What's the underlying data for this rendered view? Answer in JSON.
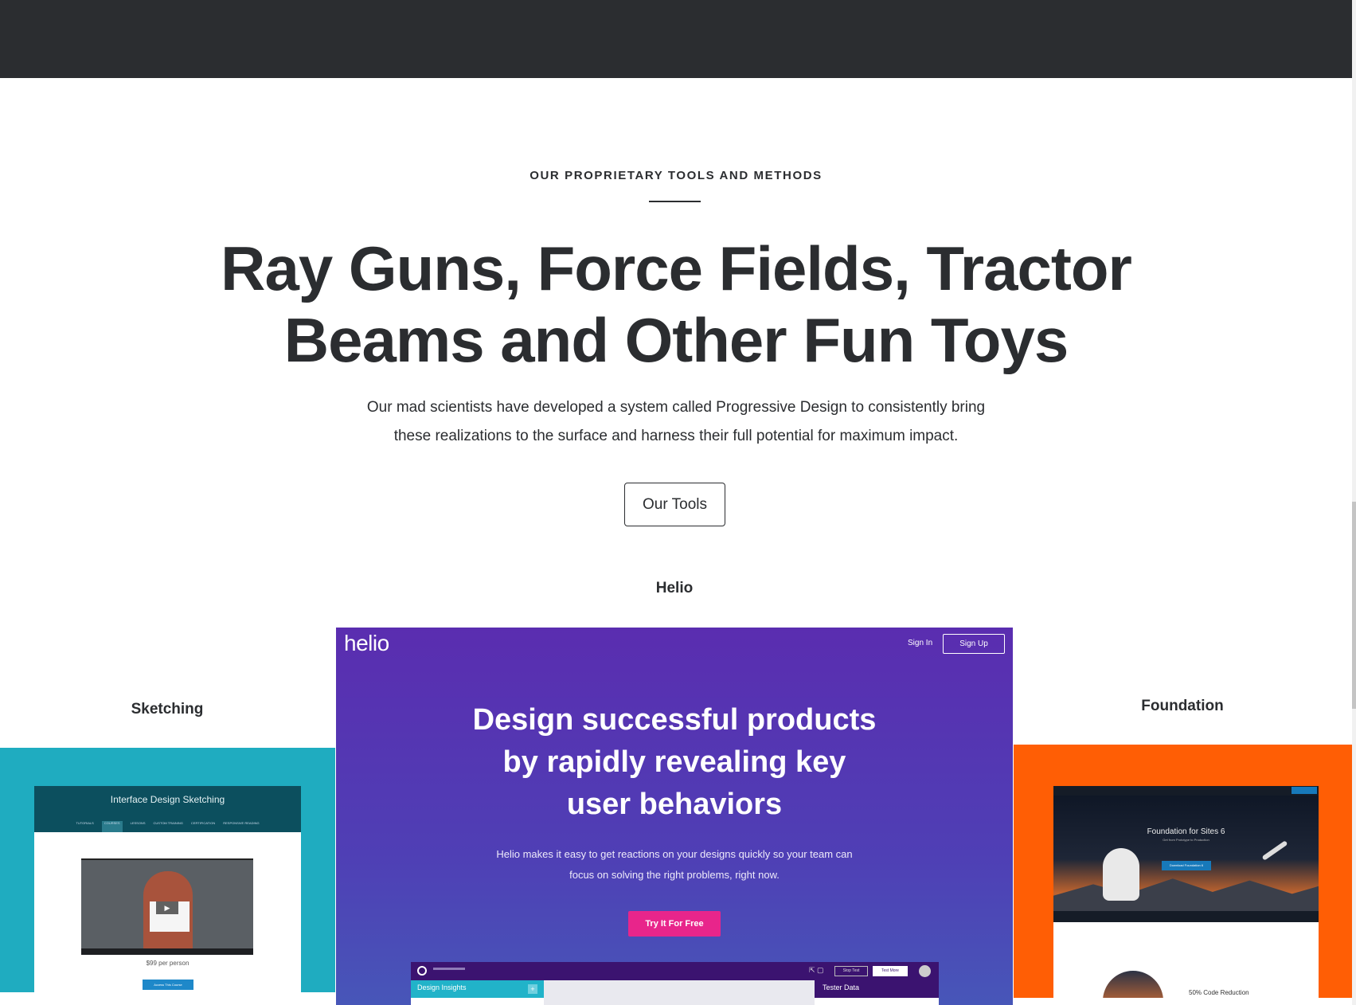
{
  "hero": {
    "eyebrow": "OUR PROPRIETARY TOOLS AND METHODS",
    "headline_line1": "Ray Guns, Force Fields, Tractor",
    "headline_line2": "Beams and Other Fun Toys",
    "lead_line1": "Our mad scientists have developed a system called Progressive Design to consistently bring",
    "lead_line2": "these realizations to the surface and harness their full potential for maximum impact.",
    "button_label": "Our Tools"
  },
  "tools": {
    "helio": {
      "label": "Helio",
      "logo": "helio",
      "sign_in": "Sign In",
      "sign_up": "Sign Up",
      "title_line1": "Design successful products",
      "title_line2": "by rapidly revealing key",
      "title_line3": "user behaviors",
      "sub_line1": "Helio makes it easy to get reactions on your designs quickly so your team can",
      "sub_line2": "focus on solving the right problems, right now.",
      "cta": "Try It For Free",
      "app": {
        "stop_label": "Stop Test",
        "test_more_label": "Test More",
        "side_label": "Design Insights",
        "right_label": "Tester Data"
      },
      "bg_color": "#5a2db0",
      "cta_color": "#e8258b"
    },
    "sketching": {
      "label": "Sketching",
      "shot_title": "Interface Design Sketching",
      "nav": [
        "TUTORIALS",
        "COURSES",
        "LESSONS",
        "CUSTOM TRAINING",
        "CERTIFICATION",
        "RESPONSIVE READING"
      ],
      "price": "$99 per person",
      "button": "Access This Course",
      "bg_color": "#1facc0"
    },
    "foundation": {
      "label": "Foundation",
      "shot_title": "Foundation for Sites 6",
      "shot_subtitle": "Get from Prototype to Production",
      "shot_button": "Download Foundation 6",
      "stat": "50% Code Reduction",
      "bg_color": "#ff5e05"
    }
  }
}
